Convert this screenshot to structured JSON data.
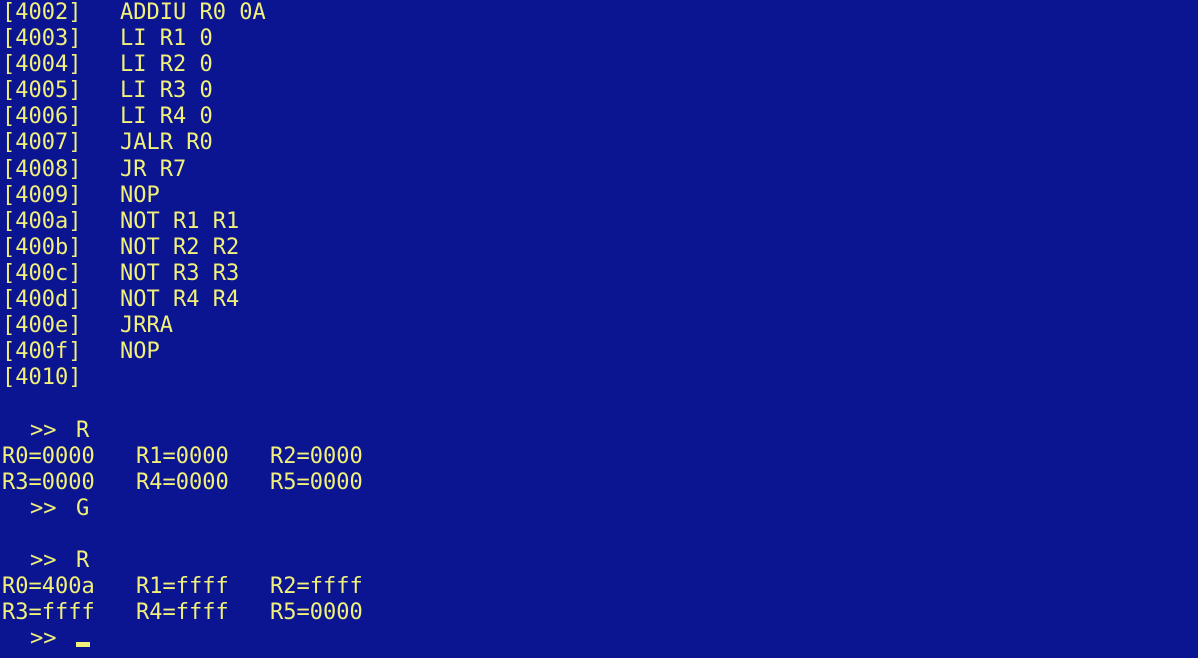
{
  "disassembly": [
    {
      "addr": "[4002]",
      "instr": "ADDIU R0 0A"
    },
    {
      "addr": "[4003]",
      "instr": "LI R1 0"
    },
    {
      "addr": "[4004]",
      "instr": "LI R2 0"
    },
    {
      "addr": "[4005]",
      "instr": "LI R3 0"
    },
    {
      "addr": "[4006]",
      "instr": "LI R4 0"
    },
    {
      "addr": "[4007]",
      "instr": "JALR R0"
    },
    {
      "addr": "[4008]",
      "instr": "JR R7"
    },
    {
      "addr": "[4009]",
      "instr": "NOP"
    },
    {
      "addr": "[400a]",
      "instr": "NOT R1 R1"
    },
    {
      "addr": "[400b]",
      "instr": "NOT R2 R2"
    },
    {
      "addr": "[400c]",
      "instr": "NOT R3 R3"
    },
    {
      "addr": "[400d]",
      "instr": "NOT R4 R4"
    },
    {
      "addr": "[400e]",
      "instr": "JRRA"
    },
    {
      "addr": "[400f]",
      "instr": "NOP"
    },
    {
      "addr": "[4010]",
      "instr": ""
    }
  ],
  "session": {
    "prompt_symbol": ">>",
    "cmd1": "R",
    "regs1": {
      "row1": [
        "R0=0000",
        "R1=0000",
        "R2=0000"
      ],
      "row2": [
        "R3=0000",
        "R4=0000",
        "R5=0000"
      ]
    },
    "cmd2": "G",
    "cmd3": "R",
    "regs2": {
      "row1": [
        "R0=400a",
        "R1=ffff",
        "R2=ffff"
      ],
      "row2": [
        "R3=ffff",
        "R4=ffff",
        "R5=0000"
      ]
    }
  },
  "colors": {
    "background": "#0c1591",
    "text": "#f0f07a"
  }
}
